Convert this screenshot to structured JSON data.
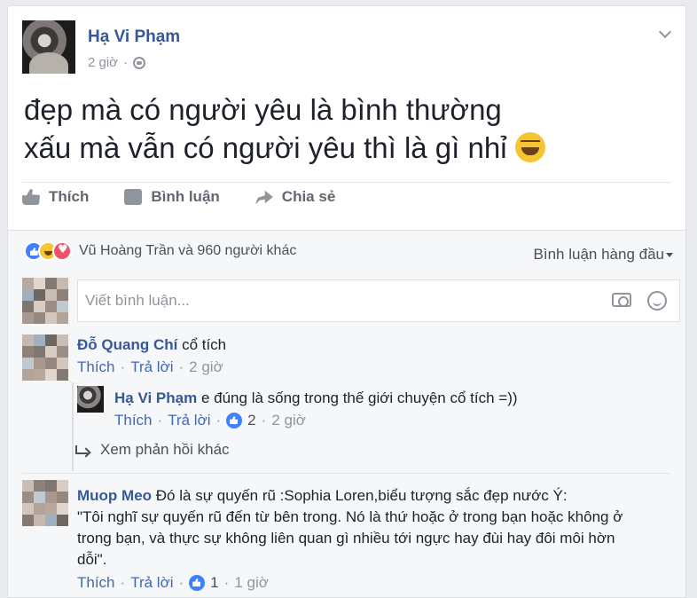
{
  "post": {
    "author": "Hạ Vi Phạm",
    "time": "2 giờ",
    "time_separator": "·",
    "text_line1": "đẹp mà có người yêu là bình thường",
    "text_line2": "xấu mà vẫn có người yêu thì là gì nhỉ",
    "emoji_icon": "laughing-tears-emoji",
    "privacy_icon": "globe-icon"
  },
  "actions": {
    "like": "Thích",
    "comment": "Bình luận",
    "share": "Chia sẻ"
  },
  "reactions": {
    "summary": "Vũ Hoàng Trần và 960 người khác",
    "types": [
      "like",
      "haha",
      "love"
    ],
    "sort_label": "Bình luận hàng đầu"
  },
  "comment_box": {
    "placeholder": "Viết bình luận..."
  },
  "comments": [
    {
      "author": "Đỗ Quang Chí",
      "text": "cổ tích",
      "like": "Thích",
      "reply": "Trả lời",
      "time": "2 giờ",
      "replies": [
        {
          "author": "Hạ Vi Phạm",
          "text": "e đúng là sống trong thế giới chuyện cổ tích =))",
          "like": "Thích",
          "reply": "Trả lời",
          "likes": "2",
          "time": "2 giờ"
        }
      ],
      "more_replies": "Xem phản hồi khác"
    },
    {
      "author": "Muop Meo",
      "text_line1": "Đó là sự quyến rũ :Sophia Loren,biểu tượng sắc đẹp nước Ý:",
      "text_line2": "\"Tôi nghĩ sự quyến rũ đến từ bên trong. Nó là thứ hoặc ở trong bạn hoặc không ở",
      "text_line3": "trong bạn, và thực sự không liên quan gì nhiều tới ngực hay đùi hay đôi môi hờn",
      "text_line4": "dỗi\".",
      "like": "Thích",
      "reply": "Trả lời",
      "likes": "1",
      "time": "1 giờ"
    }
  ],
  "colors": {
    "link": "#365899",
    "accent": "#4267b2",
    "muted": "#90949c"
  }
}
